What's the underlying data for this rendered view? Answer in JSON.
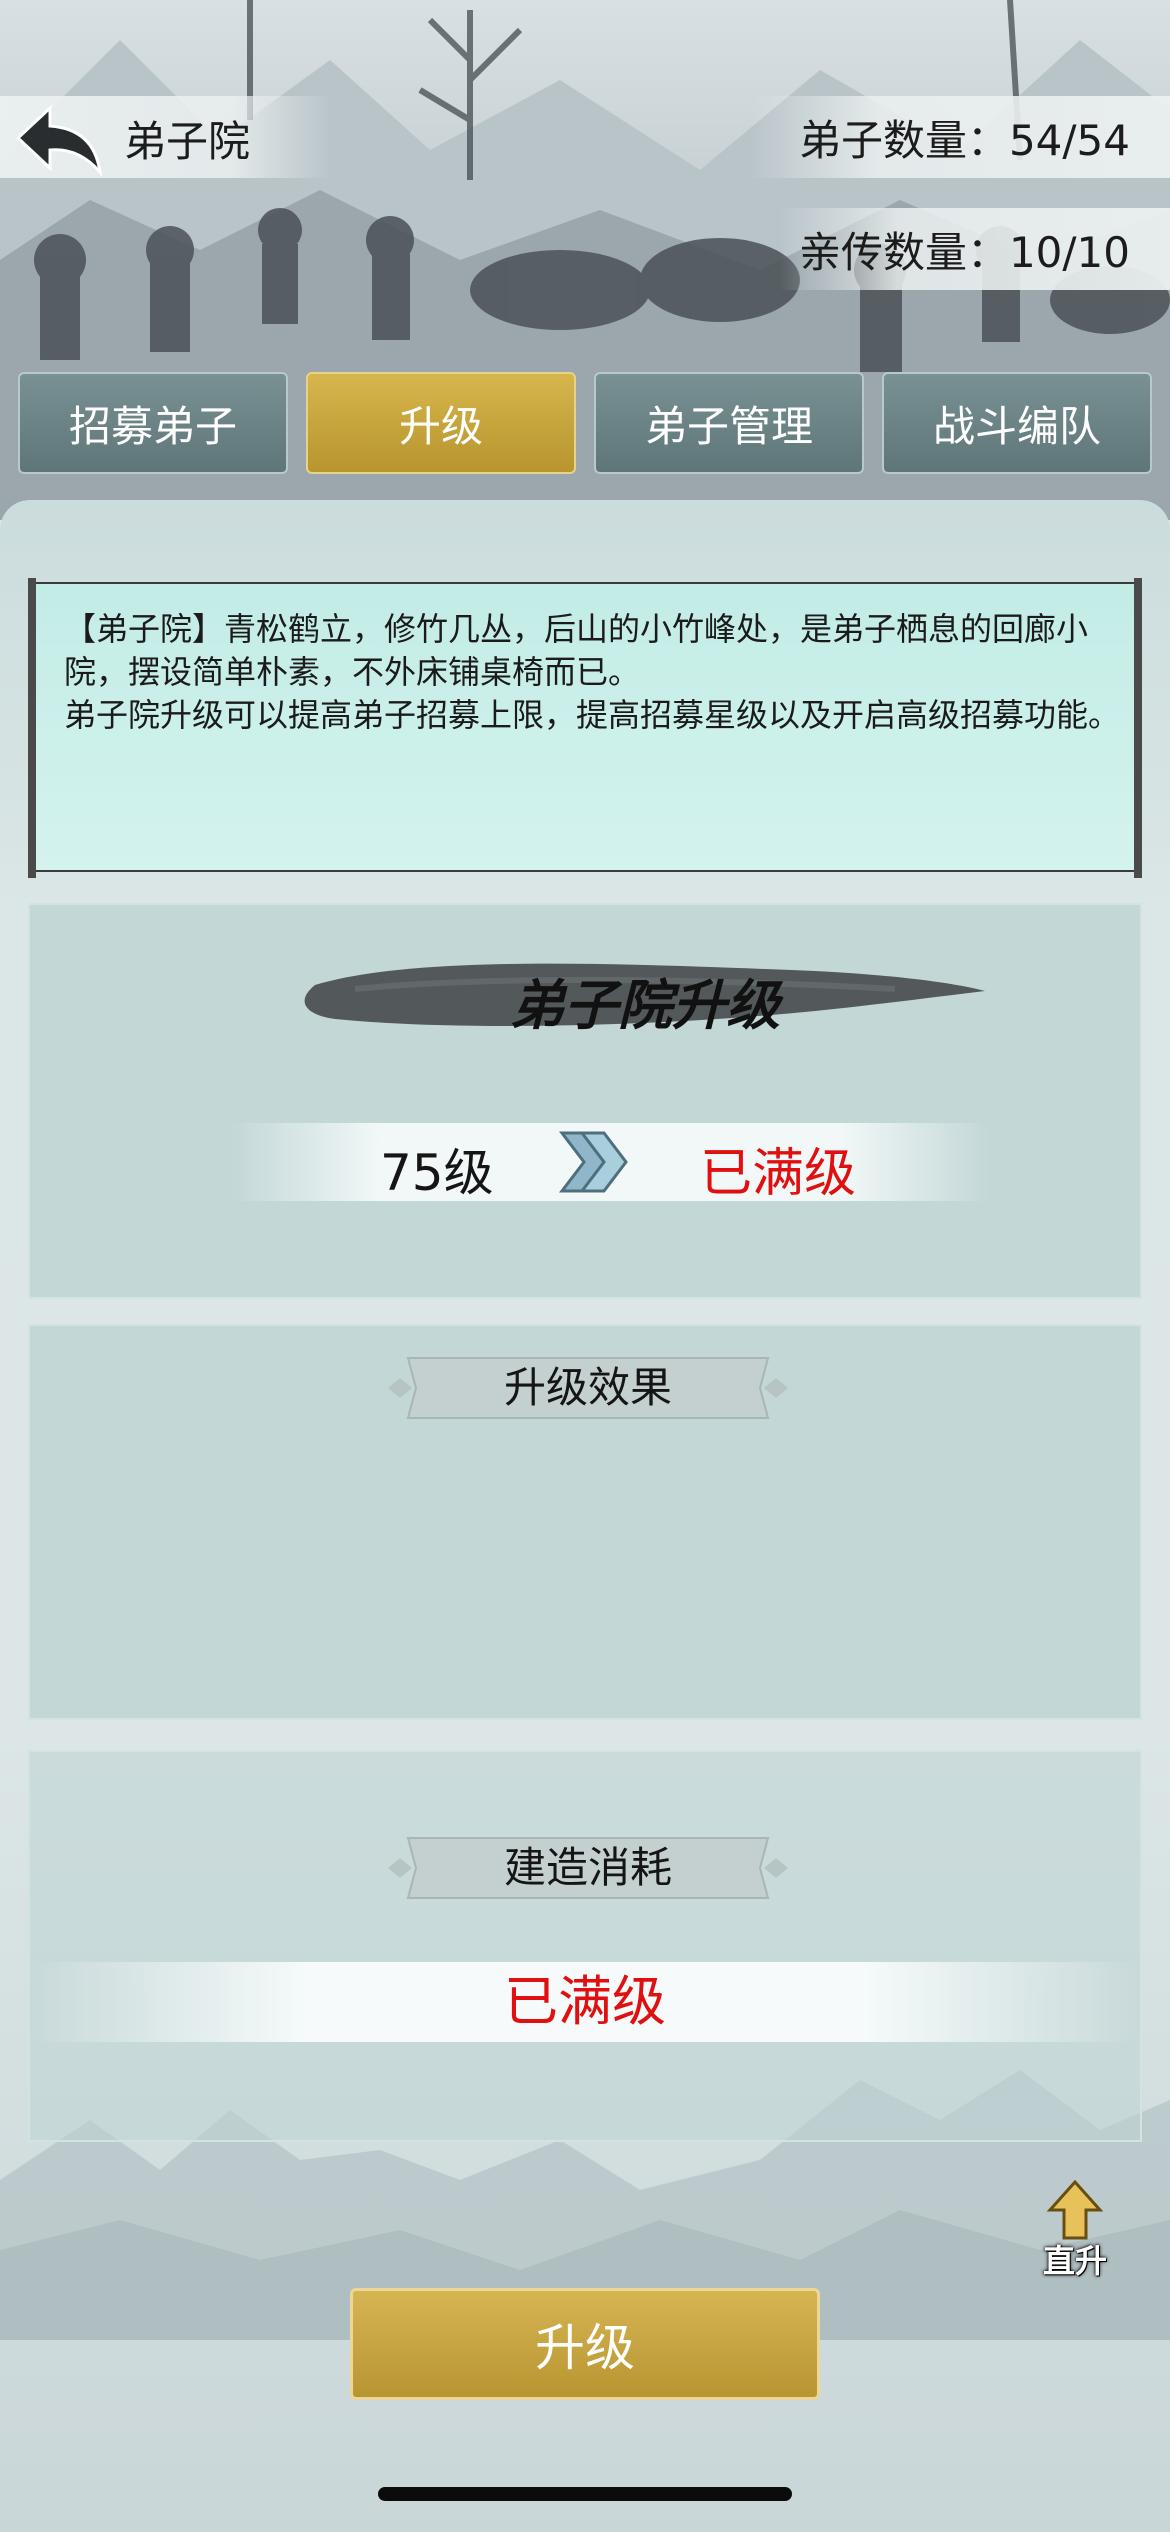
{
  "header": {
    "title": "弟子院",
    "disciple_count": "弟子数量：54/54",
    "direct_disciple_count": "亲传数量：10/10"
  },
  "tabs": [
    {
      "label": "招募弟子",
      "active": false
    },
    {
      "label": "升级",
      "active": true
    },
    {
      "label": "弟子管理",
      "active": false
    },
    {
      "label": "战斗编队",
      "active": false
    }
  ],
  "description": {
    "line1": "【弟子院】青松鹤立，修竹几丛，后山的小竹峰处，是弟子栖息的回廊小院，摆设简单朴素，不外床铺桌椅而已。",
    "line2": "弟子院升级可以提高弟子招募上限，提高招募星级以及开启高级招募功能。"
  },
  "upgrade_card": {
    "title": "弟子院升级",
    "current_level": "75级",
    "next_level": "已满级"
  },
  "effect_card": {
    "title": "升级效果"
  },
  "cost_card": {
    "title": "建造消耗",
    "status": "已满级"
  },
  "boost_button": {
    "label": "直升"
  },
  "upgrade_button": {
    "label": "升级"
  },
  "colors": {
    "active_tab": "#c7a63f",
    "inactive_tab": "#6c8386",
    "max_level_text": "#e01010",
    "scroll_bg": "#c9efe9"
  }
}
